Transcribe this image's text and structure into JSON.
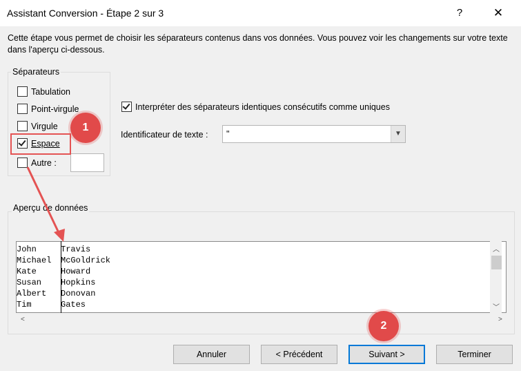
{
  "window": {
    "title": "Assistant Conversion - Étape 2 sur 3",
    "help": "?",
    "close": "✕"
  },
  "description": "Cette étape vous permet de choisir les séparateurs contenus dans vos données. Vous pouvez voir les changements sur votre texte dans l'aperçu ci-dessous.",
  "separators": {
    "label": "Séparateurs",
    "items": [
      {
        "label": "Tabulation",
        "checked": false
      },
      {
        "label": "Point-virgule",
        "checked": false
      },
      {
        "label": "Virgule",
        "checked": false
      },
      {
        "label": "Espace",
        "checked": true
      },
      {
        "label": "Autre :",
        "checked": false
      }
    ],
    "autre_value": ""
  },
  "consecutive": {
    "label": "Interpréter des séparateurs identiques consécutifs comme uniques",
    "checked": true
  },
  "text_qualifier": {
    "label": "Identificateur de texte :",
    "value": "\""
  },
  "preview": {
    "label": "Aperçu de données",
    "rows": [
      [
        "John",
        "Travis"
      ],
      [
        "Michael",
        "McGoldrick"
      ],
      [
        "Kate",
        "Howard"
      ],
      [
        "Susan",
        "Hopkins"
      ],
      [
        "Albert",
        "Donovan"
      ],
      [
        "Tim",
        "Gates"
      ]
    ]
  },
  "buttons": {
    "cancel": "Annuler",
    "back": "< Précédent",
    "next": "Suivant >",
    "finish": "Terminer"
  },
  "annotations": {
    "badge1": "1",
    "badge2": "2",
    "color": "#e14a4a"
  }
}
